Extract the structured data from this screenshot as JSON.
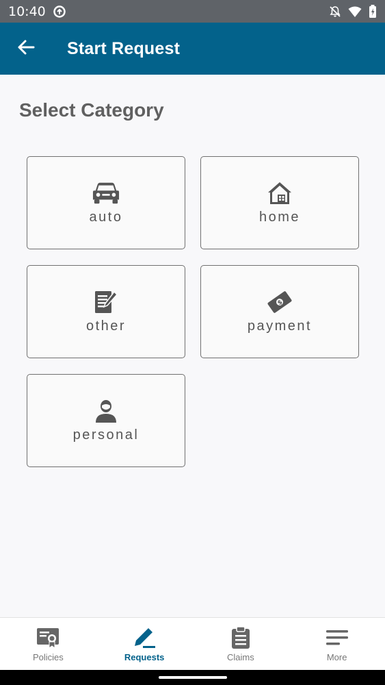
{
  "status": {
    "time": "10:40"
  },
  "app_bar": {
    "title": "Start Request"
  },
  "main": {
    "section_title": "Select Category",
    "categories": [
      {
        "label": "auto",
        "icon": "car-icon"
      },
      {
        "label": "home",
        "icon": "house-icon"
      },
      {
        "label": "other",
        "icon": "document-edit-icon"
      },
      {
        "label": "payment",
        "icon": "money-icon"
      },
      {
        "label": "personal",
        "icon": "person-icon"
      }
    ]
  },
  "bottom_nav": {
    "items": [
      {
        "label": "Policies",
        "icon": "certificate-icon",
        "active": false
      },
      {
        "label": "Requests",
        "icon": "pen-icon",
        "active": true
      },
      {
        "label": "Claims",
        "icon": "clipboard-icon",
        "active": false
      },
      {
        "label": "More",
        "icon": "menu-lines-icon",
        "active": false
      }
    ]
  },
  "colors": {
    "primary": "#03628b",
    "status_bar": "#5f6368",
    "text_gray": "#606060"
  }
}
